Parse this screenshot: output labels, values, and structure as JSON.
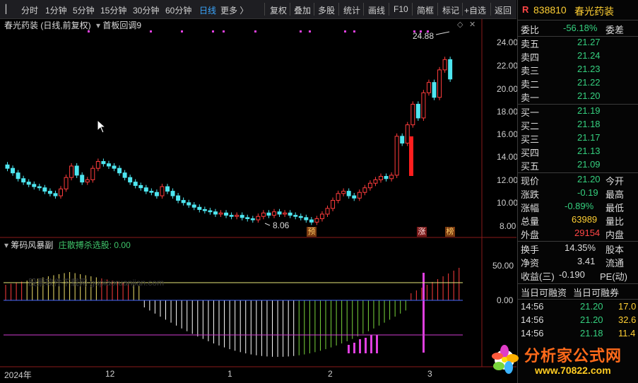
{
  "toolbar": {
    "tabs": [
      "分时",
      "1分钟",
      "5分钟",
      "15分钟",
      "30分钟",
      "60分钟",
      "日线",
      "更多 〉"
    ],
    "active_tab": "日线",
    "buttons": [
      "复权",
      "叠加",
      "多股",
      "统计",
      "画线",
      "F10",
      "简框",
      "标记",
      "+自选",
      "返回"
    ]
  },
  "chart": {
    "stock_title": "春光药装 (日线,前复权)",
    "indicator_name": "首板回调9",
    "high_label": "24.88",
    "low_label": "8.06",
    "price_ticks": [
      "24.00",
      "22.00",
      "20.00",
      "18.00",
      "16.00",
      "14.00",
      "12.00",
      "10.00",
      "8.00"
    ],
    "markers": {
      "yu": "预",
      "zhang": "涨",
      "bang": "榜"
    },
    "cursor_icon": "arrow-cursor"
  },
  "sub_chart": {
    "name": "筹码风暴副",
    "param_label": "庄散搏杀选股: 0.00",
    "ticks": [
      "50.00",
      "0.00"
    ],
    "watermark": "股票软件下载网 gupiaoruanjian.com"
  },
  "date_axis": {
    "labels": [
      "2024年",
      "12",
      "1",
      "2",
      "3"
    ]
  },
  "quote": {
    "code": "838810",
    "name": "春光药装",
    "weibi_label": "委比",
    "weibi_value": "-56.18%",
    "weicha_label": "委差",
    "sell": [
      {
        "label": "卖五",
        "price": "21.27"
      },
      {
        "label": "卖四",
        "price": "21.24"
      },
      {
        "label": "卖三",
        "price": "21.23"
      },
      {
        "label": "卖二",
        "price": "21.22"
      },
      {
        "label": "卖一",
        "price": "21.20"
      }
    ],
    "buy": [
      {
        "label": "买一",
        "price": "21.19"
      },
      {
        "label": "买二",
        "price": "21.18"
      },
      {
        "label": "买三",
        "price": "21.17"
      },
      {
        "label": "买四",
        "price": "21.13"
      },
      {
        "label": "买五",
        "price": "21.09"
      }
    ],
    "stats": [
      {
        "label": "现价",
        "value": "21.20",
        "label2": "今开"
      },
      {
        "label": "涨跌",
        "value": "-0.19",
        "label2": "最高"
      },
      {
        "label": "涨幅",
        "value": "-0.89%",
        "label2": "最低"
      },
      {
        "label": "总量",
        "value": "63989",
        "label2": "量比"
      },
      {
        "label": "外盘",
        "value": "29154",
        "label2": "内盘"
      }
    ],
    "stats2": [
      {
        "label": "换手",
        "value": "14.35%",
        "label2": "股本"
      },
      {
        "label": "净资",
        "value": "3.41",
        "label2": "流通"
      },
      {
        "label": "收益(三)",
        "value": "-0.190",
        "label2": "PE(动)"
      }
    ],
    "intraday_headers": [
      "当日可融资",
      "当日可融券"
    ],
    "ticks": [
      {
        "time": "14:56",
        "price": "21.20",
        "vol": "17.0"
      },
      {
        "time": "14:56",
        "price": "21.20",
        "vol": "32.6"
      },
      {
        "time": "14:56",
        "price": "21.18",
        "vol": "11.4"
      }
    ]
  },
  "logo": {
    "text": "分析家公式网",
    "url": "www.70822.com"
  },
  "colors": {
    "up": "#ff3c3c",
    "down": "#4ee6f0",
    "panel_bg": "#000000",
    "accent": "#3ba7ff"
  }
}
